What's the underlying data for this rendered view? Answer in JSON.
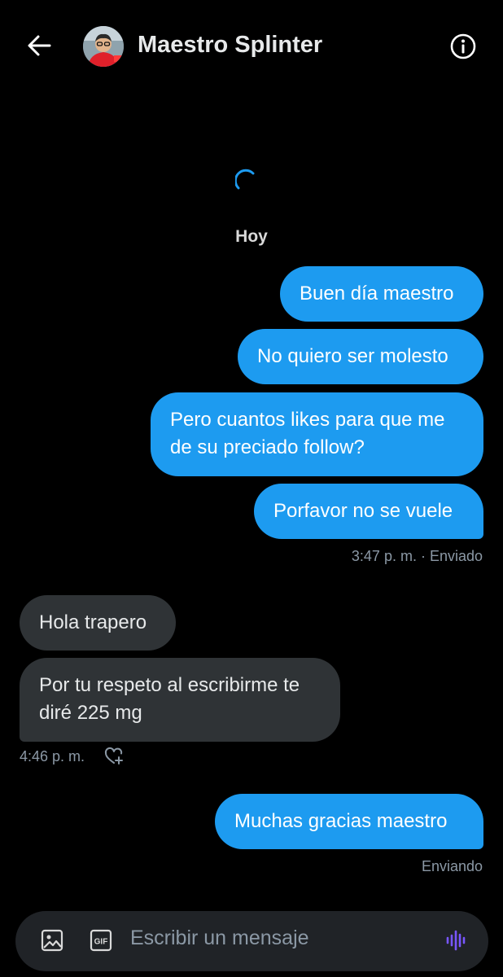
{
  "header": {
    "contact_name": "Maestro Splinter",
    "back_icon": "arrow-left-icon",
    "info_icon": "info-circle-icon",
    "avatar_icon": "contact-avatar"
  },
  "conversation": {
    "day_label": "Hoy",
    "outgoing_group_1": [
      {
        "text": "Buen día maestro"
      },
      {
        "text": "No quiero ser molesto"
      },
      {
        "text": "Pero cuantos likes para que me de su preciado follow?"
      },
      {
        "text": "Porfavor no se vuele"
      }
    ],
    "outgoing_group_1_meta": "3:47 p. m. · Enviado",
    "incoming_group": [
      {
        "text": "Hola trapero"
      },
      {
        "text": "Por tu respeto al escribirme te diré 225 mg"
      }
    ],
    "incoming_group_meta": "4:46 p. m.",
    "react_icon": "heart-plus-icon",
    "outgoing_group_2": [
      {
        "text": "Muchas gracias maestro"
      }
    ],
    "outgoing_group_2_meta": "Enviando"
  },
  "composer": {
    "placeholder": "Escribir un mensaje",
    "gif_label": "GIF",
    "image_icon": "image-icon",
    "gif_icon": "gif-icon",
    "voice_icon": "voice-wave-icon"
  },
  "colors": {
    "outgoing_bubble": "#1d9bf0",
    "incoming_bubble": "#2f3336",
    "background": "#000000",
    "voice_accent": "#7856ff"
  }
}
